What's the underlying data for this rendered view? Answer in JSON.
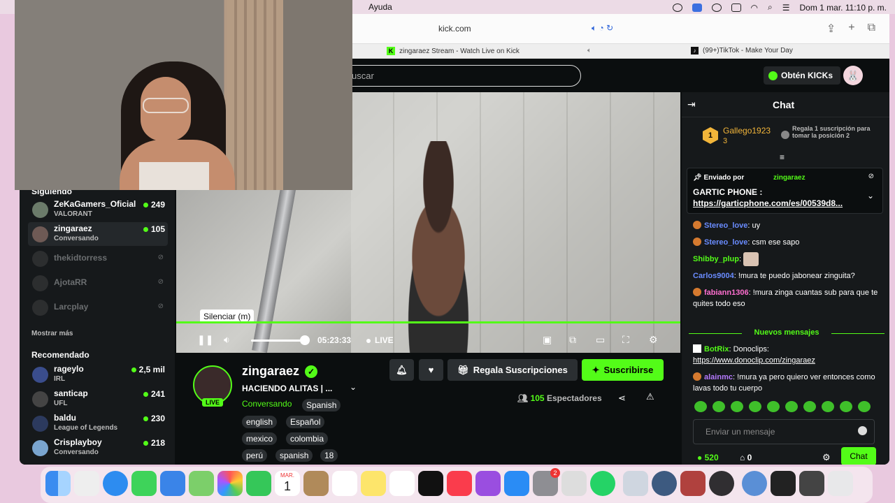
{
  "menubar": {
    "help": "Ayuda",
    "datetime": "Dom 1 mar.  11:10 p. m."
  },
  "browser": {
    "url": "kick.com",
    "tabs": [
      {
        "title": "zingaraez Stream - Watch Live on Kick"
      },
      {
        "title": "(99+)TikTok - Make Your Day"
      }
    ]
  },
  "header": {
    "search_placeholder": "uscar",
    "kicks_label": "Obtén KICKs"
  },
  "sidebar": {
    "following_title": "Siguiendo",
    "following": [
      {
        "name": "ZeKaGamers_Oficial",
        "sub": "VALORANT",
        "count": "249",
        "online": true
      },
      {
        "name": "zingaraez",
        "sub": "Conversando",
        "count": "105",
        "online": true,
        "selected": true
      },
      {
        "name": "thekidtorress",
        "online": false
      },
      {
        "name": "AjotaRR",
        "online": false
      },
      {
        "name": "Larcplay",
        "online": false
      }
    ],
    "more_label": "Mostrar más",
    "recommended_title": "Recomendado",
    "recommended": [
      {
        "name": "rageylo",
        "sub": "IRL",
        "count": "2,5 mil"
      },
      {
        "name": "santicap",
        "sub": "UFL",
        "count": "241"
      },
      {
        "name": "baldu",
        "sub": "League of Legends",
        "count": "230"
      },
      {
        "name": "Crisplayboy",
        "sub": "Conversando",
        "count": "218"
      }
    ]
  },
  "player": {
    "tooltip": "Silenciar (m)",
    "time": "05:23:33",
    "live_label": "LIVE",
    "volume": 0.85
  },
  "stream": {
    "channel": "zingaraez",
    "live_badge": "LIVE",
    "title": "HACIENDO ALITAS  | ...",
    "category": "Conversando",
    "tags": [
      "Spanish",
      "english",
      "Español",
      "mexico",
      "colombia",
      "perú",
      "spanish",
      "18"
    ],
    "gift_label": "Regala Suscripciones",
    "subscribe_label": "Suscribirse",
    "viewers_count": "105",
    "viewers_label": "Espectadores"
  },
  "chat": {
    "title": "Chat",
    "leader": {
      "rank": "1",
      "name": "Gallego1923",
      "count": "3"
    },
    "gift_prompt": "Regala 1 suscripción para tomar la posición 2",
    "pinned": {
      "by_label": "Enviado por",
      "by_user": "zingaraez",
      "text": "GARTIC PHONE :",
      "link": "https://garticphone.com/es/00539d8..."
    },
    "messages": [
      {
        "user": "Stereo_love",
        "text": ": uy",
        "color": "#6a8cff"
      },
      {
        "user": "Stereo_love",
        "text": ": csm ese sapo",
        "color": "#6a8cff"
      },
      {
        "user": "Shibby_plup",
        "text": ":",
        "color": "#53fc18"
      },
      {
        "user": "Carlos9004",
        "text": ": !mura te puedo jabonear zinguita?",
        "color": "#6a8cff"
      },
      {
        "user": "fabiann1306",
        "text": ": !mura zinga cuantas sub para que te quites todo eso",
        "color": "#ff6fd0"
      }
    ],
    "new_messages_label": "Nuevos mensajes",
    "new_messages": [
      {
        "user": "BotRix",
        "text": ": Donoclips:",
        "link": "https://www.donoclip.com/zingaraez",
        "color": "#53fc18"
      },
      {
        "user": "alainmc",
        "text": ": !mura ya pero quiero ver entonces como lavas todo tu cuerpo",
        "color": "#b57aff"
      }
    ],
    "input_placeholder": "Enviar un mensaje",
    "points": "520",
    "store_count": "0",
    "send_label": "Chat"
  },
  "dock": {
    "calendar_month": "MAR.",
    "calendar_day": "1",
    "settings_badge": "2",
    "apps": [
      "finder-icon",
      "launchpad-icon",
      "safari-icon",
      "messages-icon",
      "mail-icon",
      "maps-icon",
      "photos-icon",
      "facetime-icon",
      "calendar-icon",
      "contacts-icon",
      "reminders-icon",
      "notes-icon",
      "freeform-icon",
      "tv-icon",
      "music-icon",
      "podcasts-icon",
      "appstore-icon",
      "settings-icon",
      "iphone-mirroring-icon",
      "whatsapp-icon",
      "preview-icon",
      "quicktime-icon",
      "dictionary-icon",
      "obs-icon",
      "globe-icon",
      "screenshot-icon",
      "video-thumb-icon",
      "trash-icon"
    ]
  },
  "colors": {
    "accent": "#53fc18",
    "bg": "#0b0e0f",
    "panel": "#16191b"
  }
}
